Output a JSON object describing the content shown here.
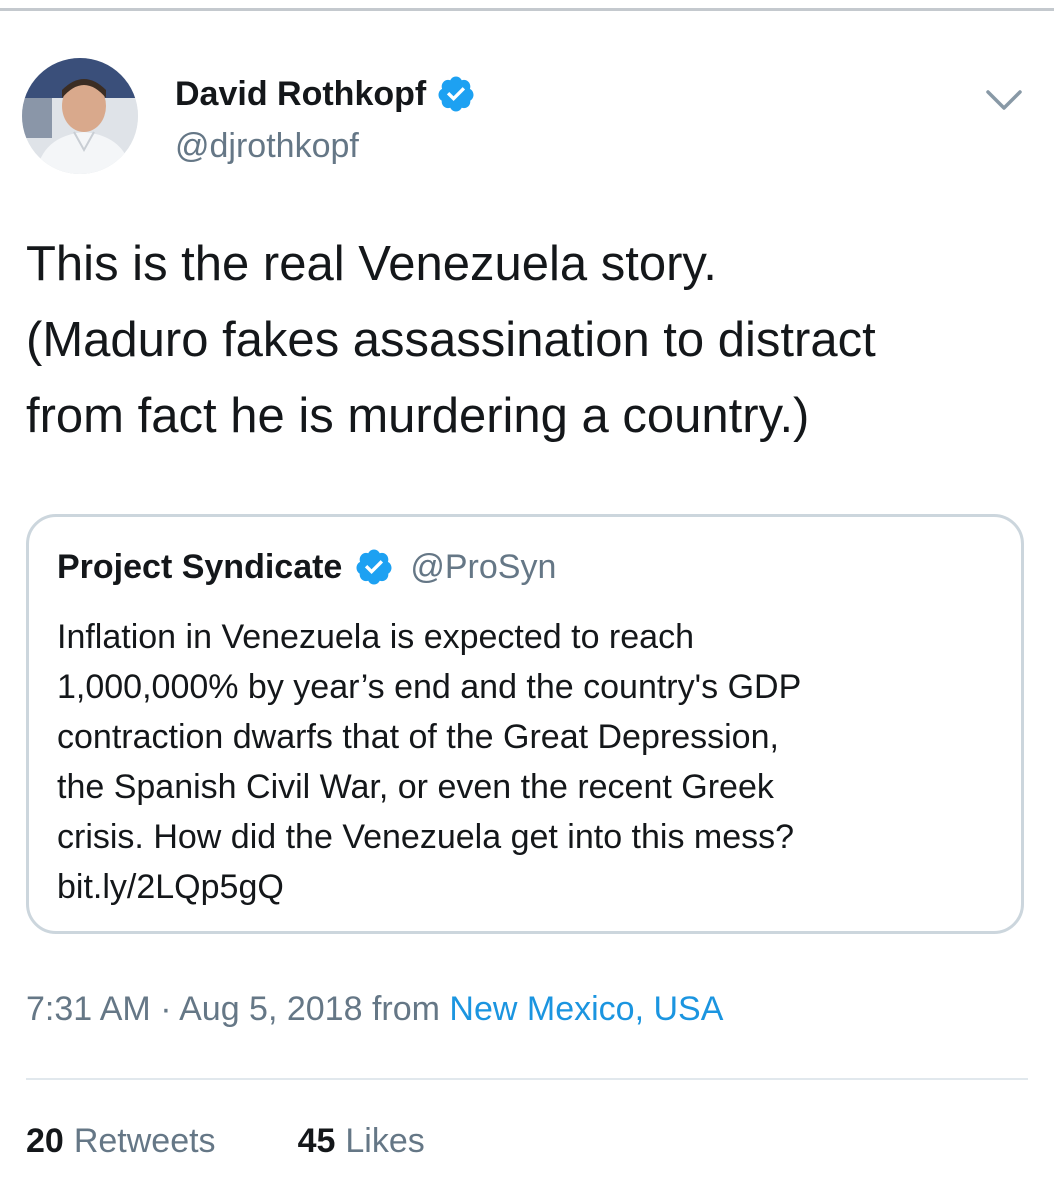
{
  "tweet": {
    "author": {
      "display_name": "David Rothkopf",
      "handle": "@djrothkopf",
      "verified": true
    },
    "text_lines": [
      "This is the real Venezuela story.",
      "(Maduro fakes assassination to distract",
      "from fact he is murdering a country.)"
    ],
    "quoted": {
      "display_name": "Project Syndicate",
      "handle": "@ProSyn",
      "verified": true,
      "text_lines": [
        "Inflation in Venezuela is expected to reach",
        "1,000,000% by year’s end and the country's GDP",
        "contraction dwarfs that of the Great Depression,",
        "the Spanish Civil War, or even the recent Greek",
        "crisis. How did the Venezuela get into this mess?",
        "bit.ly/2LQp5gQ"
      ]
    },
    "meta": {
      "time": "7:31 AM",
      "separator": "·",
      "date": "Aug 5, 2018",
      "from_label": "from",
      "location": "New Mexico, USA"
    },
    "stats": {
      "retweets_count": "20",
      "retweets_label": "Retweets",
      "likes_count": "45",
      "likes_label": "Likes"
    }
  },
  "colors": {
    "text_primary": "#14171a",
    "text_secondary": "#657786",
    "link": "#1b95e0",
    "verified": "#1da1f2",
    "border": "#ccd6dd"
  },
  "icons": {
    "verified": "verified-badge-icon",
    "more": "chevron-down-icon"
  }
}
